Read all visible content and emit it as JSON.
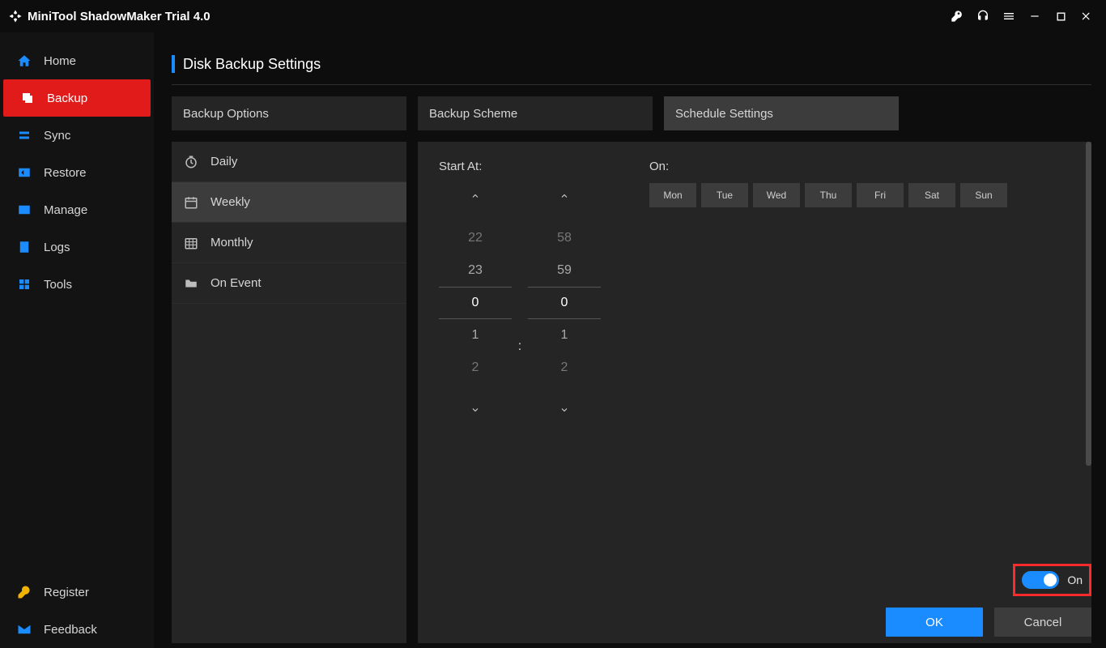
{
  "titlebar": {
    "app_title": "MiniTool ShadowMaker Trial 4.0"
  },
  "sidebar": {
    "items": [
      {
        "label": "Home"
      },
      {
        "label": "Backup"
      },
      {
        "label": "Sync"
      },
      {
        "label": "Restore"
      },
      {
        "label": "Manage"
      },
      {
        "label": "Logs"
      },
      {
        "label": "Tools"
      }
    ],
    "footer": [
      {
        "label": "Register"
      },
      {
        "label": "Feedback"
      }
    ]
  },
  "page": {
    "title": "Disk Backup Settings",
    "tabs": [
      {
        "label": "Backup Options"
      },
      {
        "label": "Backup Scheme"
      },
      {
        "label": "Schedule Settings"
      }
    ]
  },
  "schedule_modes": [
    {
      "label": "Daily"
    },
    {
      "label": "Weekly"
    },
    {
      "label": "Monthly"
    },
    {
      "label": "On Event"
    }
  ],
  "schedule": {
    "start_at_label": "Start At:",
    "on_label": "On:",
    "hours": {
      "m2": "22",
      "m1": "23",
      "sel": "0",
      "p1": "1",
      "p2": "2"
    },
    "minutes": {
      "m2": "58",
      "m1": "59",
      "sel": "0",
      "p1": "1",
      "p2": "2"
    },
    "sep": ":",
    "days": [
      "Mon",
      "Tue",
      "Wed",
      "Thu",
      "Fri",
      "Sat",
      "Sun"
    ]
  },
  "toggle": {
    "label": "On"
  },
  "buttons": {
    "ok": "OK",
    "cancel": "Cancel"
  }
}
